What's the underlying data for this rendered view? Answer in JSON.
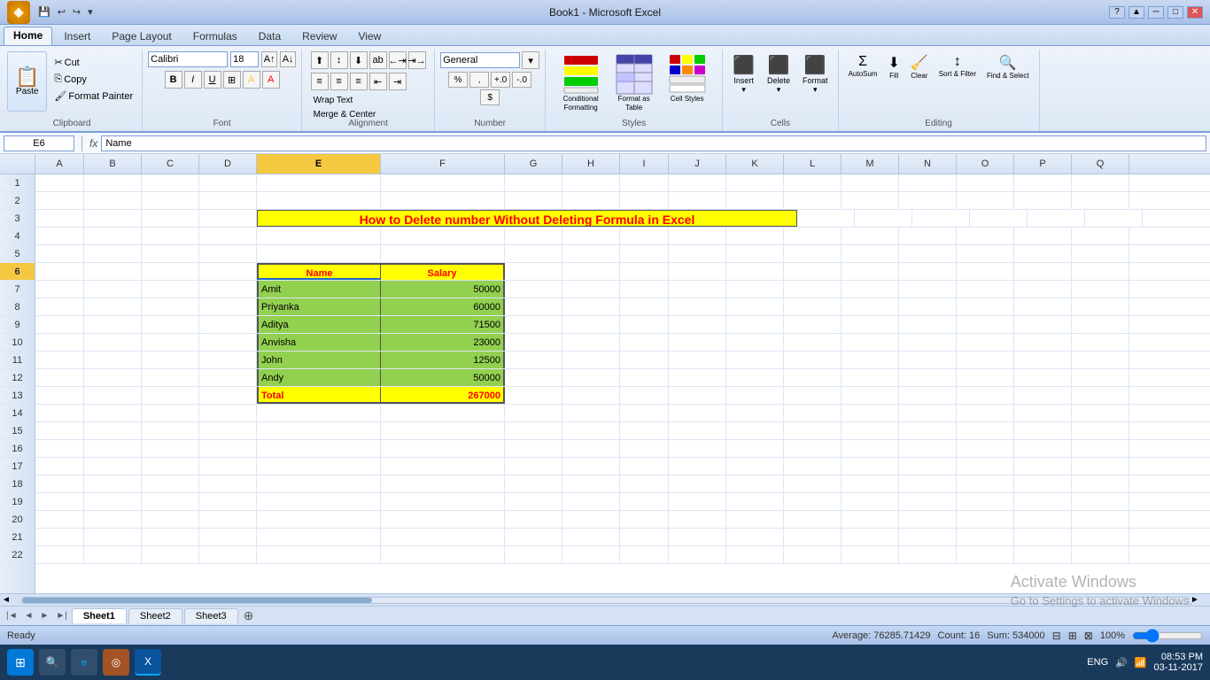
{
  "window": {
    "title": "Book1 - Microsoft Excel"
  },
  "titlebar": {
    "quickaccess": [
      "save",
      "undo",
      "redo",
      "customize"
    ],
    "min": "─",
    "max": "□",
    "close": "✕"
  },
  "tabs": [
    "Home",
    "Insert",
    "Page Layout",
    "Formulas",
    "Data",
    "Review",
    "View"
  ],
  "activeTab": "Home",
  "ribbon": {
    "clipboard": {
      "label": "Clipboard",
      "paste": "Paste",
      "cut": "Cut",
      "copy": "Copy",
      "formatPainter": "Format Painter"
    },
    "font": {
      "label": "Font",
      "fontName": "Calibri",
      "fontSize": "18",
      "bold": "B",
      "italic": "I",
      "underline": "U",
      "borders": "⊞",
      "fillColor": "A",
      "fontColor": "A"
    },
    "alignment": {
      "label": "Alignment",
      "wrapText": "Wrap Text",
      "mergecenter": "Merge & Center"
    },
    "number": {
      "label": "Number",
      "format": "General"
    },
    "styles": {
      "label": "Styles",
      "conditionalFormatting": "Conditional Formatting",
      "formatAsTable": "Format as Table",
      "cellStyles": "Cell Styles"
    },
    "cells": {
      "label": "Cells",
      "insert": "Insert",
      "delete": "Delete",
      "format": "Format"
    },
    "editing": {
      "label": "Editing",
      "autosum": "AutoSum",
      "fill": "Fill",
      "clear": "Clear",
      "sortFilter": "Sort & Filter",
      "findSelect": "Find & Select"
    }
  },
  "formulaBar": {
    "cellRef": "E6",
    "formula": "Name"
  },
  "columns": [
    "A",
    "B",
    "C",
    "D",
    "E",
    "F",
    "G",
    "H",
    "I",
    "J",
    "K",
    "L",
    "M",
    "N",
    "O",
    "P",
    "Q"
  ],
  "rows": [
    1,
    2,
    3,
    4,
    5,
    6,
    7,
    8,
    9,
    10,
    11,
    12,
    13,
    14,
    15,
    16,
    17,
    18,
    19,
    20,
    21,
    22
  ],
  "spreadsheet": {
    "title": "How to Delete number Without Deleting Formula in Excel",
    "titleRow": 3,
    "titleColStart": "D",
    "titleColEnd": "K",
    "tableData": {
      "headerRow": 6,
      "headers": [
        "Name",
        "Salary"
      ],
      "rows": [
        {
          "name": "Amit",
          "salary": 50000
        },
        {
          "name": "Priyanka",
          "salary": 60000
        },
        {
          "name": "Aditya",
          "salary": 71500
        },
        {
          "name": "Anvisha",
          "salary": 23000
        },
        {
          "name": "John",
          "salary": 12500
        },
        {
          "name": "Andy",
          "salary": 50000
        }
      ],
      "totalLabel": "Total",
      "totalValue": "267000"
    }
  },
  "sheets": [
    "Sheet1",
    "Sheet2",
    "Sheet3"
  ],
  "activeSheet": "Sheet1",
  "statusBar": {
    "ready": "Ready",
    "average": "Average: 76285.71429",
    "count": "Count: 16",
    "sum": "Sum: 534000",
    "zoom": "100%"
  },
  "taskbar": {
    "time": "08:53 PM",
    "date": "03-11-2017",
    "language": "ENG"
  },
  "watermark": {
    "line1": "Activate Windows",
    "line2": "Go to Settings to activate Windows."
  }
}
